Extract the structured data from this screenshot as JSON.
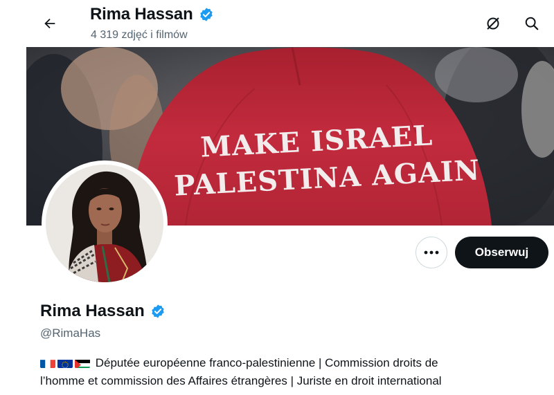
{
  "header": {
    "name": "Rima Hassan",
    "media_count": "4 319 zdjęć i filmów"
  },
  "banner": {
    "cap_line1": "MAKE ISRAEL",
    "cap_line2": "PALESTINA AGAIN"
  },
  "profile": {
    "name": "Rima Hassan",
    "handle": "@RimaHas",
    "follow_label": "Obserwuj",
    "bio_line1": "Députée européenne franco-palestinienne  | Commission droits de",
    "bio_line2": "l’homme et commission des Affaires étrangères | Juriste en droit international",
    "flags": [
      "france-flag",
      "eu-flag",
      "palestine-flag"
    ]
  },
  "colors": {
    "verified": "#1d9bf0",
    "cap_red": "#b8283a",
    "follow_bg": "#0f1419"
  }
}
